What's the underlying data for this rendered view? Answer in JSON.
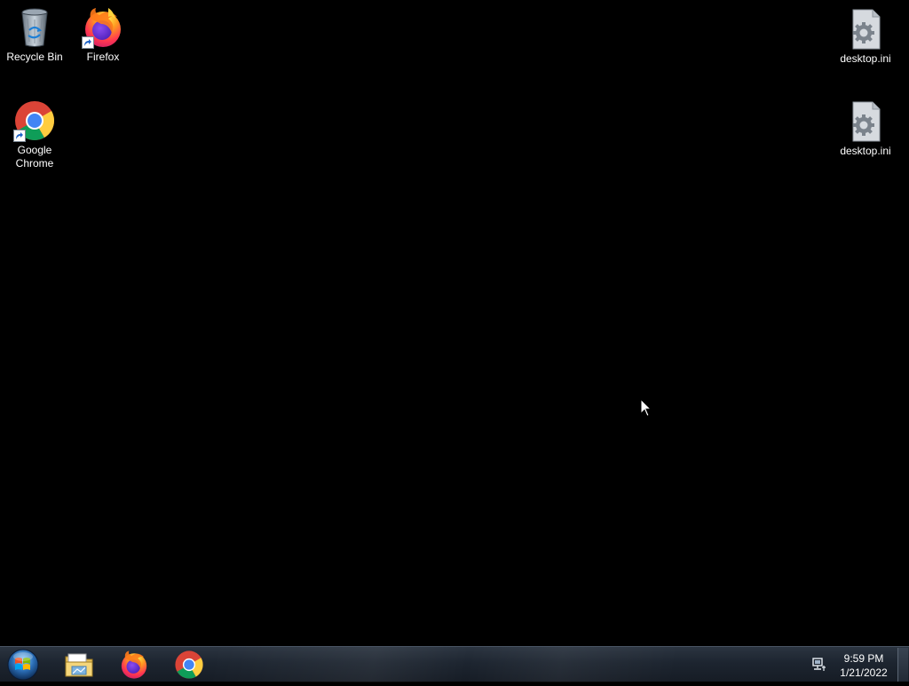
{
  "desktop": {
    "icons": [
      {
        "label": "Recycle Bin",
        "icon": "recycle-bin-icon"
      },
      {
        "label": "Firefox",
        "icon": "firefox-icon",
        "shortcut": true
      },
      {
        "label": "Google Chrome",
        "icon": "chrome-icon",
        "shortcut": true
      },
      {
        "label": "desktop.ini",
        "icon": "settings-file-icon"
      },
      {
        "label": "desktop.ini",
        "icon": "settings-file-icon"
      }
    ]
  },
  "taskbar": {
    "start_icon": "windows-start-icon",
    "pinned": [
      {
        "name": "File Explorer",
        "icon": "folder-icon"
      },
      {
        "name": "Firefox",
        "icon": "firefox-icon"
      },
      {
        "name": "Google Chrome",
        "icon": "chrome-icon"
      }
    ],
    "tray": {
      "network_icon": "network-icon",
      "time": "9:59 PM",
      "date": "1/21/2022"
    }
  },
  "colors": {
    "desktop_background": "#000000",
    "taskbar_top": "#2b3440",
    "taskbar_bottom": "#161c25",
    "label_text": "#ffffff"
  }
}
